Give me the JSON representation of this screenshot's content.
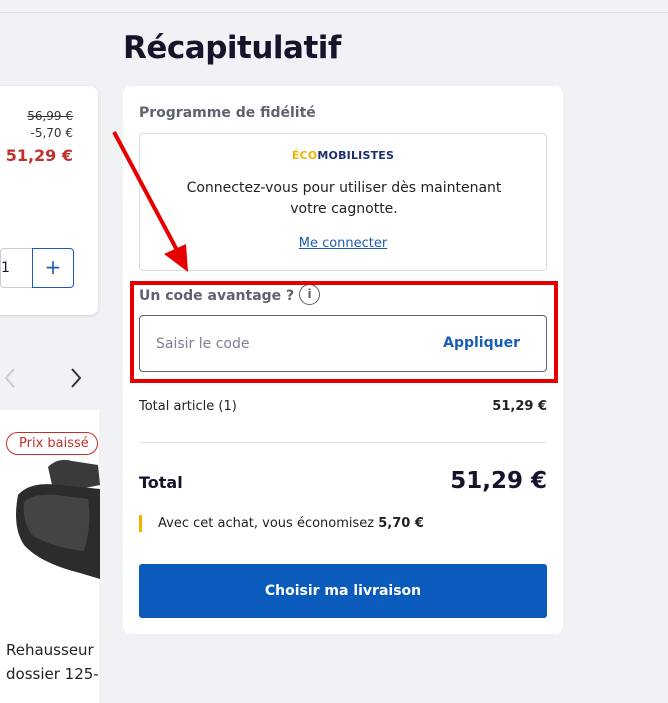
{
  "page": {
    "title": "Récapitulatif"
  },
  "product": {
    "old_price": "56,99 €",
    "discount": "-5,70 €",
    "price": "51,29 €",
    "quantity": "1",
    "plus_label": "+"
  },
  "recommendation": {
    "badge": "Prix baissé",
    "name_line1": "Rehausseur",
    "name_line2": "dossier 125-"
  },
  "loyalty": {
    "title": "Programme de fidélité",
    "logo_prefix": "ÉCO",
    "logo_suffix": "MOBILISTES",
    "message": "Connectez-vous pour utiliser dès maintenant votre cagnotte.",
    "link": "Me connecter"
  },
  "promo": {
    "label": "Un code avantage ?",
    "info_icon": "i",
    "placeholder": "Saisir le code",
    "apply": "Appliquer"
  },
  "totals": {
    "items_label": "Total article (1)",
    "items_value": "51,29 €",
    "total_label": "Total",
    "total_value": "51,29 €",
    "saving_text": "Avec cet achat, vous économisez",
    "saving_amount": "5,70 €"
  },
  "cta": {
    "label": "Choisir ma livraison"
  },
  "colors": {
    "accent": "#0b5bbd",
    "price_red": "#c1302b",
    "annotation_red": "#e60000",
    "saving_yellow": "#f0b400"
  }
}
